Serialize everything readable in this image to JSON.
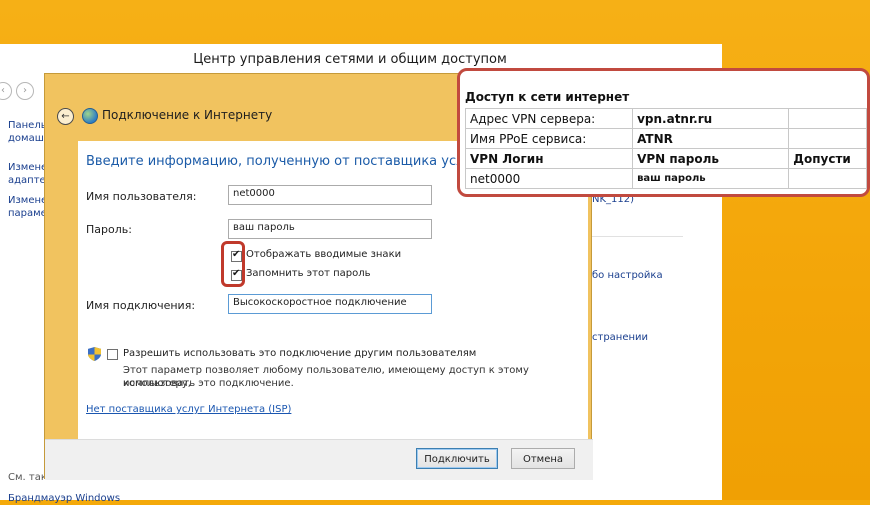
{
  "background_window": {
    "title": "Центр управления сетями и общим доступом",
    "sidebar": [
      "Панель",
      "домаш",
      "Измене",
      "адаптер",
      "Измене",
      "параме"
    ],
    "see_also": "См. также",
    "firewall": "Брандмауэр Windows",
    "fragments": [
      "NK_112)",
      "бо настройка",
      "странении"
    ]
  },
  "dialog": {
    "title": "Подключение к Интернету",
    "heading": "Введите информацию, полученную от поставщика услуг Интернета (ISP)",
    "username": {
      "label": "Имя пользователя:",
      "value": "net0000"
    },
    "password": {
      "label": "Пароль:",
      "value": "ваш пароль"
    },
    "show_chars": {
      "label": "Отображать вводимые знаки",
      "checked": true
    },
    "remember": {
      "label": "Запомнить этот пароль",
      "checked": true
    },
    "connection_name": {
      "label": "Имя подключения:",
      "value": "Высокоскоростное подключение"
    },
    "share": {
      "label": "Разрешить использовать это подключение другим пользователям",
      "checked": false,
      "description_line1": "Этот параметр позволяет любому пользователю, имеющему доступ к этому компьютеру,",
      "description_line2": "использовать это подключение."
    },
    "isp_link": "Нет поставщика услуг Интернета (ISP)",
    "connect_button": "Подключить",
    "cancel_button": "Отмена"
  },
  "callout": {
    "title": "Доступ к сети интернет",
    "vpn_server_label": "Адрес VPN сервера:",
    "vpn_server_value": "vpn.atnr.ru",
    "service_label": "Имя PPoE сервиса:",
    "service_value": "ATNR",
    "col_login": "VPN Логин",
    "col_password": "VPN пароль",
    "col_access": "Допусти",
    "login_value": "net0000",
    "password_value": "ваш пароль"
  }
}
